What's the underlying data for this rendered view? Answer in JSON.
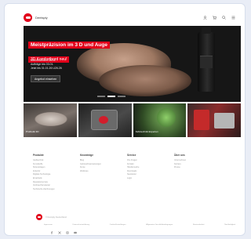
{
  "header": {
    "brand": "Dentsply",
    "icons": [
      "user-icon",
      "cart-icon",
      "search-icon",
      "menu-icon"
    ]
  },
  "hero": {
    "title": "Meistpräzision im 3 D und Auge",
    "subtitle": "3D Komfortbord neu!",
    "details": [
      "Kennenlernen 28.01.",
      "Aufträge bis 03.01.",
      "Jetzt bis 31.01.26 U26.26"
    ],
    "cta_label": "Angebot einsehen",
    "slides": 3,
    "active_slide": 1,
    "colors": {
      "accent": "#e2001a",
      "background": "#161616"
    }
  },
  "tiles": [
    {
      "label": "Prothetik 3D"
    },
    {
      "label": ""
    },
    {
      "label": "Zahntechnik Experten"
    },
    {
      "label": ""
    }
  ],
  "footer": {
    "columns": [
      {
        "title": "Produkte",
        "links": [
          "Gießtechnik",
          "Kunststoffe",
          "Sinteranlagen",
          "Zubehör",
          "Digitale Technologie",
          "Ersatzteile",
          "Reparaturservice",
          "Verbrauchsmaterial",
          "Technische Zeichnungen"
        ]
      },
      {
        "title": "Knowledge",
        "links": [
          "Blog",
          "Gebrauchsanweisungen",
          "Kurse",
          "Webinare"
        ]
      },
      {
        "title": "Service",
        "links": [
          "Ihre Fragen",
          "Kontakt",
          "Händlersuche",
          "Downloads",
          "Newsletter",
          "Login"
        ]
      },
      {
        "title": "Über uns",
        "links": [
          "Unternehmen",
          "Karriere",
          "Presse"
        ]
      }
    ],
    "copyright": "© Dentsply Deutschland",
    "legal": [
      "Impressum",
      "Datenschutzerklärung",
      "Cookie-Einstellungen",
      "Allgemeine Geschäftsbedingungen",
      "Barrierefreiheit",
      "Nachhaltigkeit"
    ],
    "social_icons": [
      "facebook-icon",
      "twitter-icon",
      "instagram-icon",
      "youtube-icon"
    ],
    "language": "DE"
  }
}
